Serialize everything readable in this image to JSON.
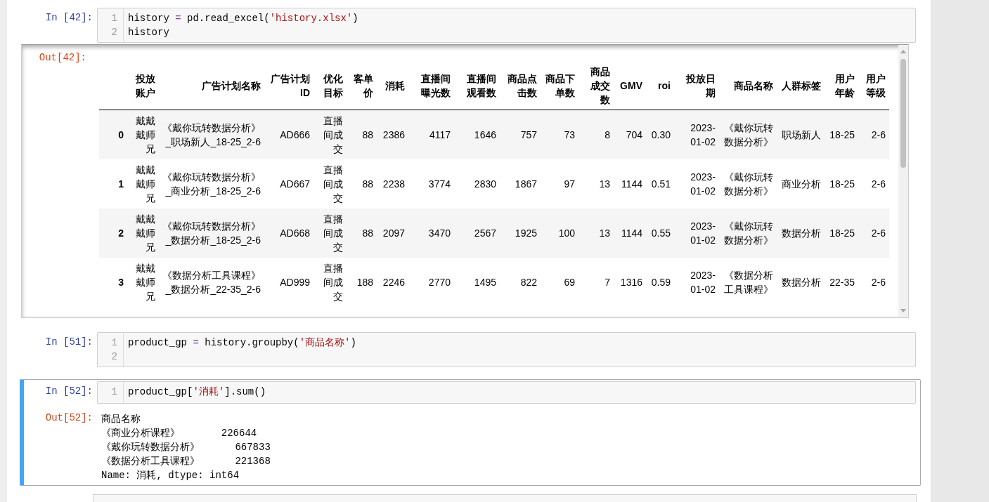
{
  "cells": [
    {
      "prompt": "In [42]:",
      "selected": false,
      "lines": [
        {
          "number": "1",
          "tokens": [
            {
              "kind": "plain",
              "text": "history "
            },
            {
              "kind": "op",
              "text": "="
            },
            {
              "kind": "plain",
              "text": " pd.read_excel("
            },
            {
              "kind": "str",
              "text": "'history.xlsx'"
            },
            {
              "kind": "plain",
              "text": ")"
            }
          ]
        },
        {
          "number": "2",
          "tokens": [
            {
              "kind": "plain",
              "text": "history"
            }
          ]
        }
      ],
      "output": {
        "prompt": "Out[42]:",
        "kind": "table",
        "table": {
          "columns": [
            "投放账户",
            "广告计划名称",
            "广告计划ID",
            "优化目标",
            "客单价",
            "消耗",
            "直播间曝光数",
            "直播间观看数",
            "商品点击数",
            "商品下单数",
            "商品成交数",
            "GMV",
            "roi",
            "投放日期",
            "商品名称",
            "人群标签",
            "用户年龄",
            "用户等级"
          ],
          "rows": [
            {
              "index": "0",
              "cells": [
                "戴戴戴师兄",
                "《戴你玩转数据分析》_职场新人_18-25_2-6",
                "AD666",
                "直播间成交",
                "88",
                "2386",
                "4117",
                "1646",
                "757",
                "73",
                "8",
                "704",
                "0.30",
                "2023-01-02",
                "《戴你玩转数据分析》",
                "职场新人",
                "18-25",
                "2-6"
              ]
            },
            {
              "index": "1",
              "cells": [
                "戴戴戴师兄",
                "《戴你玩转数据分析》_商业分析_18-25_2-6",
                "AD667",
                "直播间成交",
                "88",
                "2238",
                "3774",
                "2830",
                "1867",
                "97",
                "13",
                "1144",
                "0.51",
                "2023-01-02",
                "《戴你玩转数据分析》",
                "商业分析",
                "18-25",
                "2-6"
              ]
            },
            {
              "index": "2",
              "cells": [
                "戴戴戴师兄",
                "《戴你玩转数据分析》_数据分析_18-25_2-6",
                "AD668",
                "直播间成交",
                "88",
                "2097",
                "3470",
                "2567",
                "1925",
                "100",
                "13",
                "1144",
                "0.55",
                "2023-01-02",
                "《戴你玩转数据分析》",
                "数据分析",
                "18-25",
                "2-6"
              ]
            },
            {
              "index": "3",
              "cells": [
                "戴戴戴师兄",
                "《数据分析工具课程》_数据分析_22-35_2-6",
                "AD999",
                "直播间成交",
                "188",
                "2246",
                "2770",
                "1495",
                "822",
                "69",
                "7",
                "1316",
                "0.59",
                "2023-01-02",
                "《数据分析工具课程》",
                "数据分析",
                "22-35",
                "2-6"
              ]
            }
          ]
        }
      }
    },
    {
      "prompt": "In [51]:",
      "selected": false,
      "lines": [
        {
          "number": "1",
          "tokens": [
            {
              "kind": "plain",
              "text": "product_gp "
            },
            {
              "kind": "op",
              "text": "="
            },
            {
              "kind": "plain",
              "text": " history.groupby("
            },
            {
              "kind": "str",
              "text": "'商品名称'"
            },
            {
              "kind": "plain",
              "text": ")"
            }
          ]
        },
        {
          "number": "2"
        }
      ]
    },
    {
      "prompt": "In [52]:",
      "selected": true,
      "lines": [
        {
          "number": "1",
          "tokens": [
            {
              "kind": "plain",
              "text": "product_gp["
            },
            {
              "kind": "str",
              "text": "'消耗'"
            },
            {
              "kind": "plain",
              "text": "].sum()"
            }
          ]
        }
      ],
      "output": {
        "prompt": "Out[52]:",
        "kind": "text",
        "lines": [
          "商品名称",
          "《商业分析课程》       226644",
          "《戴你玩转数据分析》      667833",
          "《数据分析工具课程》      221368",
          "Name: 消耗, dtype: int64"
        ]
      }
    }
  ]
}
